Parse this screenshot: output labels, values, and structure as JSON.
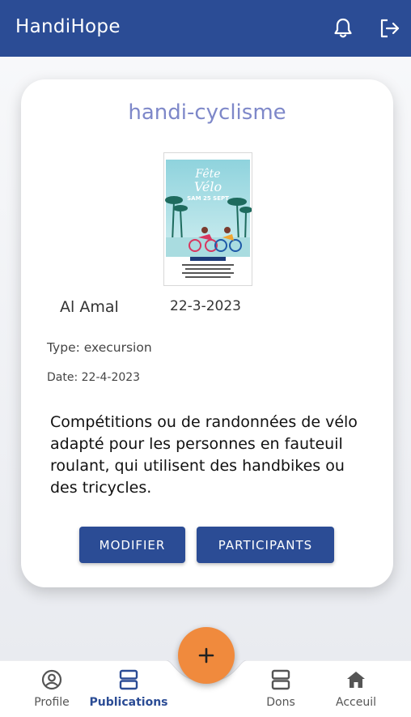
{
  "app": {
    "title": "HandiHope",
    "accent_color": "#2b4c95",
    "fab_color": "#f08a3d",
    "icons": {
      "notifications": "bell-icon",
      "logout": "logout-icon"
    }
  },
  "publication": {
    "title": "handi-cyclisme",
    "poster": {
      "headline_line1": "Fête",
      "headline_line2": "Vélo",
      "date_line": "SAM 25 SEPT"
    },
    "author": "Al Amal",
    "published_date": "22-3-2023",
    "type_label": "Type: execursion",
    "event_date_label": "Date: 22-4-2023",
    "description": "Compétitions ou de randonnées de vélo adapté pour les personnes en fauteuil roulant, qui utilisent des handbikes ou des tricycles.",
    "buttons": {
      "modifier": "MODIFIER",
      "participants": "PARTICIPANTS"
    }
  },
  "bottom_nav": {
    "items": [
      {
        "label": "Profile",
        "icon": "account-circle-icon",
        "active": false
      },
      {
        "label": "Publications",
        "icon": "stacked-rows-icon",
        "active": true
      },
      {
        "label": "Dons",
        "icon": "stacked-rows-icon",
        "active": false
      },
      {
        "label": "Acceuil",
        "icon": "home-icon",
        "active": false
      }
    ],
    "fab_label": "+"
  }
}
